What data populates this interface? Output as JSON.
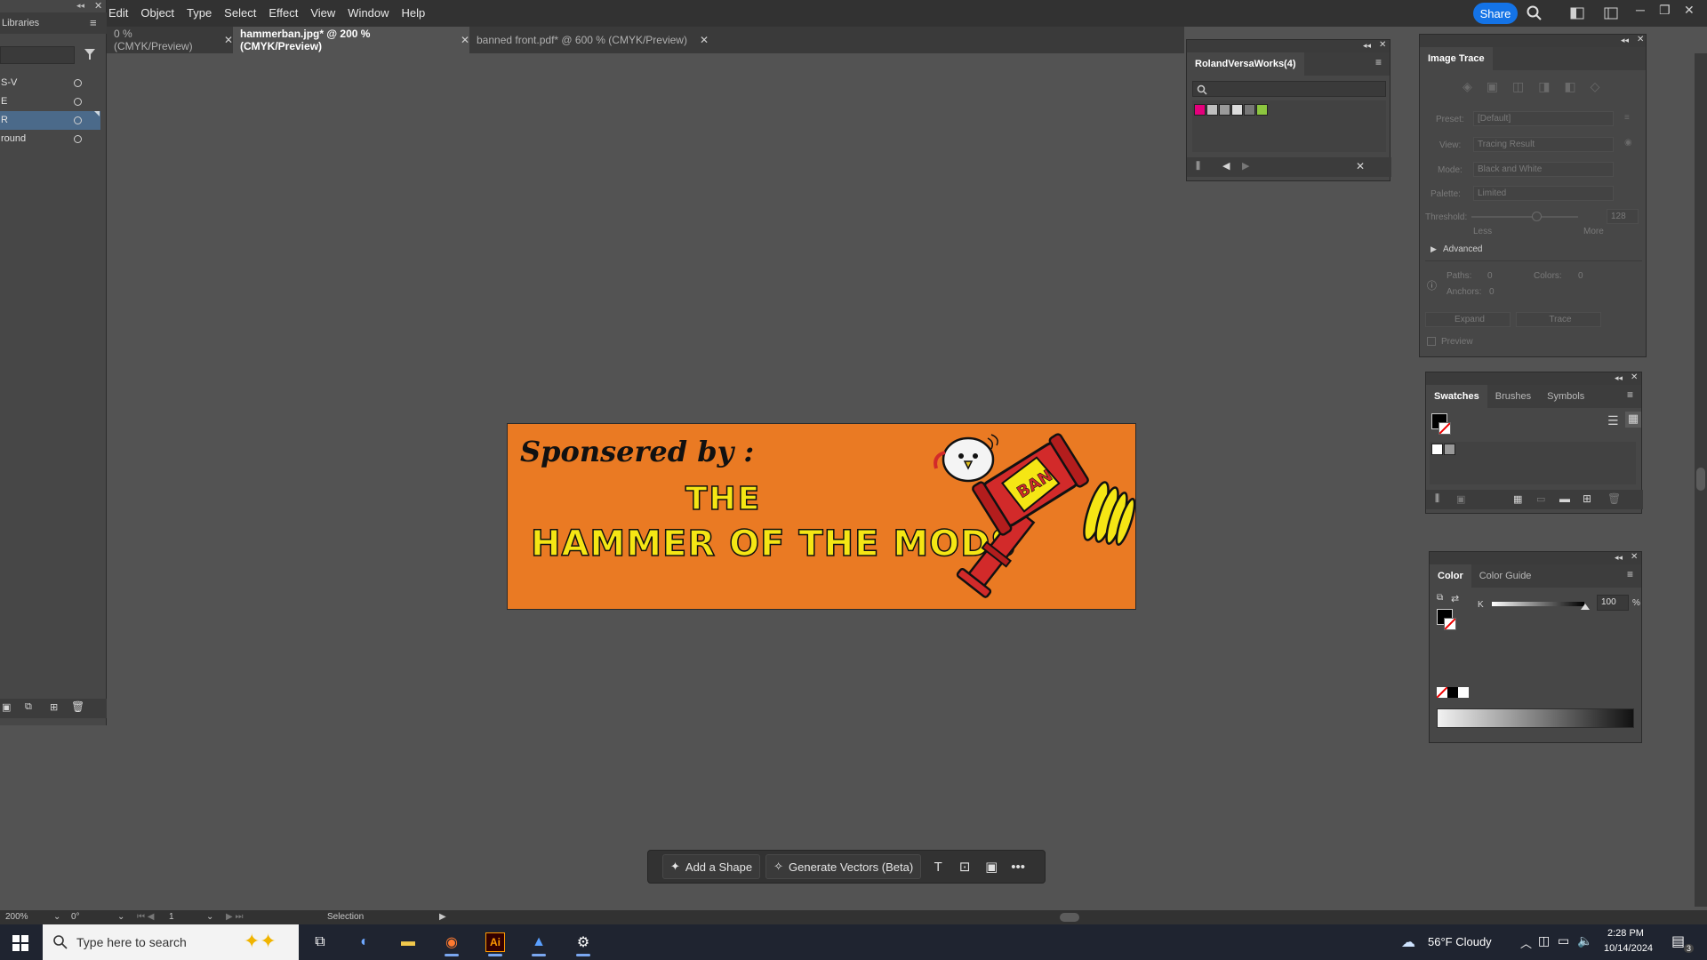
{
  "menubar": {
    "items": [
      "Edit",
      "Object",
      "Type",
      "Select",
      "Effect",
      "View",
      "Window",
      "Help"
    ],
    "share_label": "Share"
  },
  "doc_tabs": [
    {
      "label": "0 % (CMYK/Preview)",
      "active": false
    },
    {
      "label": "hammerban.jpg* @ 200 % (CMYK/Preview)",
      "active": true
    },
    {
      "label": "banned front.pdf* @ 600 % (CMYK/Preview)",
      "active": false
    }
  ],
  "left_panel": {
    "title": "Libraries",
    "layers": [
      {
        "name": "S-V",
        "selected": false
      },
      {
        "name": "E",
        "selected": false
      },
      {
        "name": "R",
        "selected": true
      },
      {
        "name": "round",
        "selected": false
      }
    ]
  },
  "artwork": {
    "sponsor_text": "Sponsered by :",
    "the_text": "THE",
    "title_text": "HAMMER OF THE MODS",
    "ban_text": "BAN",
    "bg_color": "#ea7a23"
  },
  "roland_panel": {
    "title": "RolandVersaWorks(4)",
    "search_placeholder": ""
  },
  "image_trace": {
    "title": "Image Trace",
    "preset_label": "Preset:",
    "preset_value": "[Default]",
    "view_label": "View:",
    "view_value": "Tracing Result",
    "mode_label": "Mode:",
    "mode_value": "Black and White",
    "palette_label": "Palette:",
    "palette_value": "Limited",
    "threshold_label": "Threshold:",
    "threshold_value": "128",
    "less_label": "Less",
    "more_label": "More",
    "advanced_label": "Advanced",
    "paths_label": "Paths:",
    "paths_value": "0",
    "colors_label": "Colors:",
    "colors_value": "0",
    "anchors_label": "Anchors:",
    "anchors_value": "0",
    "expand_label": "Expand",
    "trace_label": "Trace",
    "preview_label": "Preview"
  },
  "swatches_panel": {
    "tabs": [
      "Swatches",
      "Brushes",
      "Symbols"
    ]
  },
  "color_panel": {
    "tabs": [
      "Color",
      "Color Guide"
    ],
    "k_label": "K",
    "k_value": "100",
    "percent": "%"
  },
  "ctx_bar": {
    "add_shape": "Add a Shape",
    "generate_vectors": "Generate Vectors (Beta)"
  },
  "statusbar": {
    "zoom": "200%",
    "rotation": "0°",
    "artboard": "1",
    "tool": "Selection"
  },
  "taskbar": {
    "search_placeholder": "Type here to search",
    "weather": "56°F  Cloudy",
    "time": "2:28 PM",
    "date": "10/14/2024",
    "notification_count": "3"
  }
}
